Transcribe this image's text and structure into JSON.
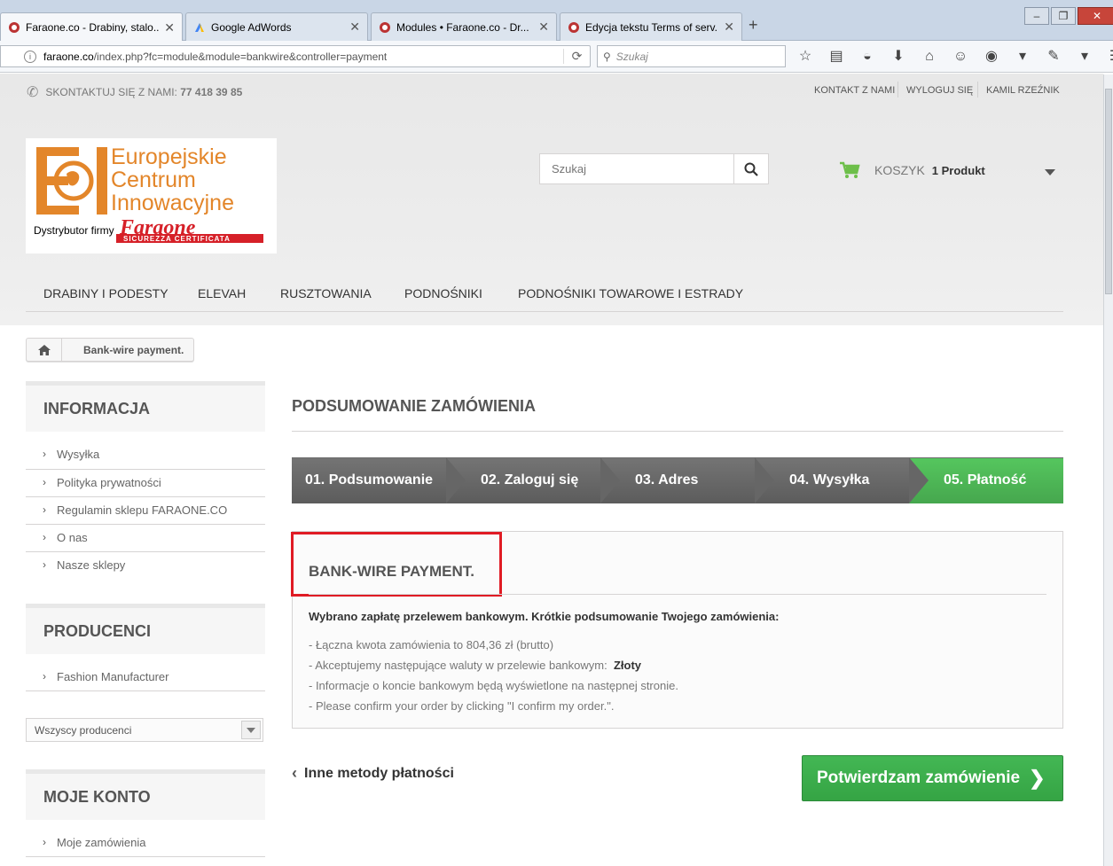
{
  "browser": {
    "tabs": [
      {
        "title": "Faraone.co - Drabiny, stalo...",
        "active": true
      },
      {
        "title": "Google AdWords",
        "active": false
      },
      {
        "title": "Modules • Faraone.co - Dr...",
        "active": false
      },
      {
        "title": "Edycja tekstu Terms of serv...",
        "active": false
      }
    ],
    "new_tab": "+",
    "url_host": "faraone.co",
    "url_path": "/index.php?fc=module&module=bankwire&controller=payment",
    "search_placeholder": "Szukaj",
    "window_controls": [
      "minimize",
      "maximize",
      "close"
    ]
  },
  "header": {
    "contact_label": "SKONTAKTUJ SIĘ Z NAMI:",
    "contact_phone": "77 418 39 85",
    "links": [
      "KONTAKT Z NAMI",
      "WYLOGUJ SIĘ",
      "KAMIL RZEŹNIK"
    ],
    "logo": {
      "line1": "Europejskie",
      "line2": "Centrum",
      "line3": "Innowacyjne",
      "distributor": "Dystrybutor firmy",
      "brand": "Faraone",
      "brand_tagline": "SICUREZZA CERTIFICATA"
    },
    "search_placeholder": "Szukaj",
    "cart_label": "KOSZYK",
    "cart_count": "1 Produkt",
    "menu": [
      "DRABINY I PODESTY",
      "ELEVAH",
      "RUSZTOWANIA",
      "PODNOŚNIKI",
      "PODNOŚNIKI TOWAROWE I ESTRADY"
    ]
  },
  "breadcrumb": {
    "current": "Bank-wire payment."
  },
  "sidebar": {
    "info_title": "INFORMACJA",
    "info_items": [
      "Wysyłka",
      "Polityka prywatności",
      "Regulamin sklepu FARAONE.CO",
      "O nas",
      "Nasze sklepy"
    ],
    "producers_title": "PRODUCENCI",
    "producers_items": [
      "Fashion Manufacturer"
    ],
    "producers_select": "Wszyscy producenci",
    "account_title": "MOJE KONTO",
    "account_items": [
      "Moje zamówienia"
    ]
  },
  "main": {
    "heading": "PODSUMOWANIE ZAMÓWIENIA",
    "steps": [
      "01. Podsumowanie",
      "02. Zaloguj się",
      "03. Adres",
      "04. Wysyłka",
      "05. Płatność"
    ],
    "payment_title": "BANK-WIRE PAYMENT.",
    "intro": "Wybrano zapłatę przelewem bankowym. Krótkie podsumowanie Twojego zamówienia:",
    "line1": "- Łączna kwota zamówienia to 804,36 zł (brutto)",
    "line2_prefix": "- Akceptujemy następujące waluty w przelewie bankowym:",
    "line2_currency": "Złoty",
    "line3": "- Informacje o koncie bankowym będą wyświetlone na następnej stronie.",
    "line4": "- Please confirm your order by clicking \"I confirm my order.\".",
    "back_label": "Inne metody płatności",
    "confirm_label": "Potwierdzam zamówienie"
  },
  "colors": {
    "accent_green": "#46a74e",
    "logo_orange": "#e3862a",
    "highlight_red": "#e01b24"
  }
}
